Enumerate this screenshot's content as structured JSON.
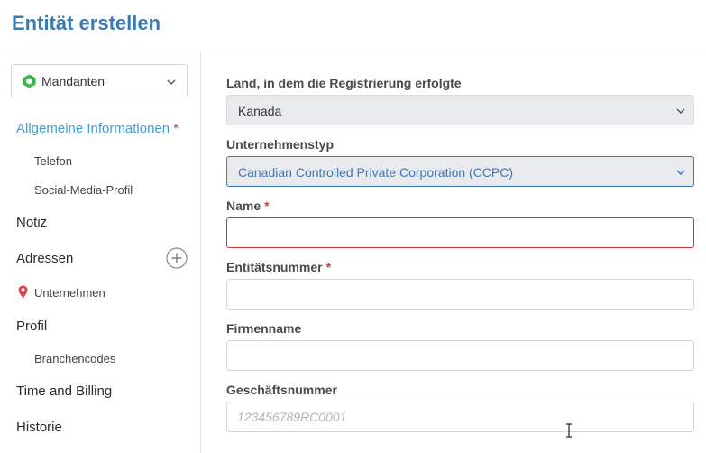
{
  "page": {
    "title": "Entität erstellen"
  },
  "sidebar": {
    "selector": {
      "label": "Mandanten",
      "icon": "hexagon-icon"
    },
    "items": [
      {
        "label": "Allgemeine Informationen",
        "required_mark": "*",
        "active": true
      },
      {
        "label": "Telefon",
        "sub": true
      },
      {
        "label": "Social-Media-Profil",
        "sub": true
      },
      {
        "label": "Notiz"
      },
      {
        "label": "Adressen",
        "icon": "plus-circle-icon"
      },
      {
        "label": "Unternehmen",
        "sub": true,
        "icon": "map-pin-icon"
      },
      {
        "label": "Profil"
      },
      {
        "label": "Branchencodes",
        "sub": true
      },
      {
        "label": "Time and Billing"
      },
      {
        "label": "Historie"
      }
    ]
  },
  "form": {
    "country": {
      "label": "Land, in dem die Registrierung erfolgte",
      "value": "Kanada"
    },
    "company_type": {
      "label": "Unternehmenstyp",
      "value": "Canadian Controlled Private Corporation (CCPC)"
    },
    "name": {
      "label": "Name",
      "required_mark": "*",
      "value": ""
    },
    "entity_number": {
      "label": "Entitätsnummer",
      "required_mark": "*",
      "value": ""
    },
    "company_name": {
      "label": "Firmenname",
      "value": ""
    },
    "business_number": {
      "label": "Geschäftsnummer",
      "placeholder": "123456789RC0001",
      "value": ""
    }
  },
  "colors": {
    "accent": "#3b7bb4",
    "active_nav": "#3d9ed9",
    "required": "#d9303b",
    "hexagon": "#3cb54a"
  }
}
